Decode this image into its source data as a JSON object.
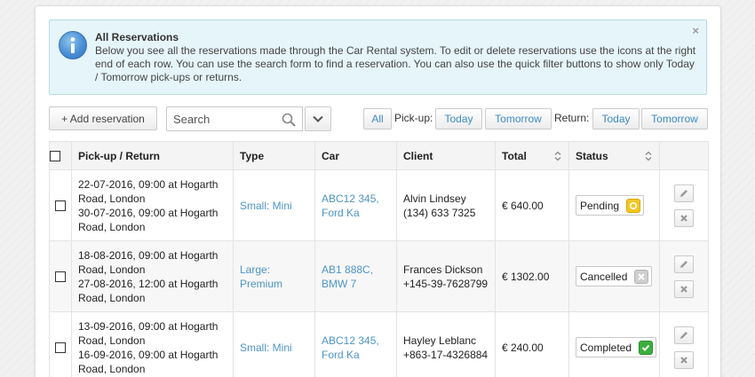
{
  "info": {
    "title": "All Reservations",
    "text": "Below you see all the reservations made through the Car Rental system. To edit or delete reservations use the icons at the right end of each row. You can use the search form to find a reservation. You can also use the quick filter buttons to show only Today / Tomorrow pick-ups or returns.",
    "close": "×",
    "icon": "info-icon"
  },
  "toolbar": {
    "add_label": "+ Add reservation",
    "search_placeholder": "Search",
    "filter_all": "All",
    "pickup_label": "Pick-up:",
    "return_label": "Return:",
    "today": "Today",
    "tomorrow": "Tomorrow"
  },
  "table": {
    "headers": [
      "Pick-up / Return",
      "Type",
      "Car",
      "Client",
      "Total",
      "Status"
    ],
    "rows": [
      {
        "pickup_line1": "22-07-2016, 09:00 at Hogarth",
        "pickup_line2": "Road, London",
        "return_line1": "30-07-2016, 09:00 at Hogarth",
        "return_line2": "Road, London",
        "type_line1": "Small: Mini",
        "type_line2": "",
        "car_line1": "ABC12 345,",
        "car_line2": "Ford Ka",
        "client_name": "Alvin Lindsey",
        "client_phone": "(134) 633 7325",
        "total": "€ 640.00",
        "status": "Pending"
      },
      {
        "pickup_line1": "18-08-2016, 09:00 at Hogarth",
        "pickup_line2": "Road, London",
        "return_line1": "27-08-2016, 12:00 at Hogarth",
        "return_line2": "Road, London",
        "type_line1": "Large:",
        "type_line2": "Premium",
        "car_line1": "AB1 888C,",
        "car_line2": "BMW 7",
        "client_name": "Frances Dickson",
        "client_phone": "+145-39-7628799",
        "total": "€ 1302.00",
        "status": "Cancelled"
      },
      {
        "pickup_line1": "13-09-2016, 09:00 at Hogarth",
        "pickup_line2": "Road, London",
        "return_line1": "16-09-2016, 09:00 at Hogarth",
        "return_line2": "Road, London",
        "type_line1": "Small: Mini",
        "type_line2": "",
        "car_line1": "ABC12 345,",
        "car_line2": "Ford Ka",
        "client_name": "Hayley Leblanc",
        "client_phone": "+863-17-4326884",
        "total": "€ 240.00",
        "status": "Completed"
      }
    ]
  },
  "colors": {
    "link": "#4d95c7",
    "info_bg": "#e6f5fa",
    "pending": "#f3c623",
    "cancelled": "#cfcfcf",
    "completed": "#3cae3c"
  }
}
